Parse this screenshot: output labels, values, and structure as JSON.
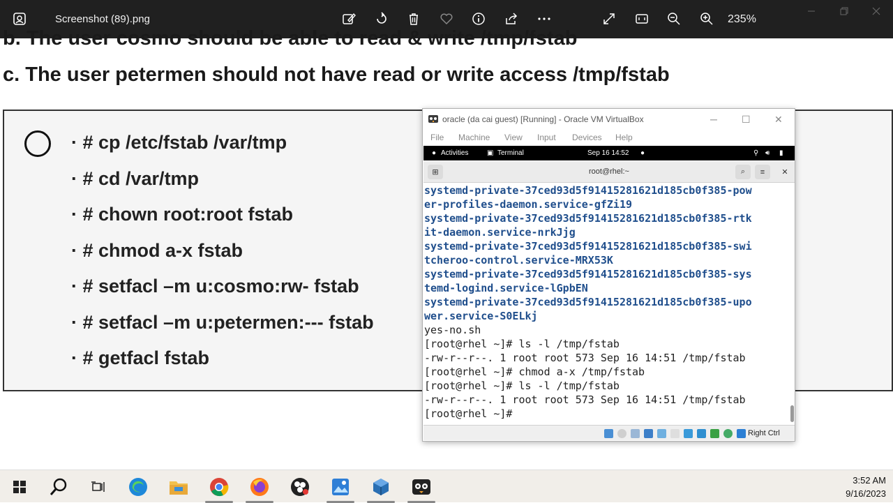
{
  "viewer": {
    "file_title": "Screenshot (89).png",
    "zoom_level": "235%",
    "icons": [
      "edit-image-icon",
      "rotate-icon",
      "delete-icon",
      "favorite-icon",
      "info-icon",
      "share-icon",
      "more-icon",
      "fullscreen-icon",
      "fit-icon",
      "zoom-out-icon",
      "zoom-in-icon"
    ]
  },
  "slide": {
    "line_b": "b. The user cosmo should be able to read & write /tmp/fstab",
    "line_c": "c. The user petermen should not have read or write access /tmp/fstab",
    "commands": [
      "· # cp /etc/fstab /var/tmp",
      "· # cd /var/tmp",
      "· # chown root:root fstab",
      "· # chmod a-x fstab",
      "· # setfacl –m u:cosmo:rw- fstab",
      "· # setfacl –m u:petermen:--- fstab",
      "· # getfacl fstab"
    ]
  },
  "vbox": {
    "title": "oracle (da cai guest) [Running] - Oracle VM VirtualBox",
    "menu": [
      "File",
      "Machine",
      "View",
      "Input",
      "Devices",
      "Help"
    ],
    "gnome": {
      "activities": "Activities",
      "terminal": "Terminal",
      "datetime": "Sep 16  14:52"
    },
    "terminal_title": "root@rhel:~",
    "right_ctrl": "Right Ctrl"
  },
  "terminal_lines": [
    {
      "text": "systemd-private-37ced93d5f91415281621d185cb0f385-pow",
      "dir": true
    },
    {
      "text": "er-profiles-daemon.service-gfZi19",
      "dir": true
    },
    {
      "text": "systemd-private-37ced93d5f91415281621d185cb0f385-rtk",
      "dir": true
    },
    {
      "text": "it-daemon.service-nrkJjg",
      "dir": true
    },
    {
      "text": "systemd-private-37ced93d5f91415281621d185cb0f385-swi",
      "dir": true
    },
    {
      "text": "tcheroo-control.service-MRX53K",
      "dir": true
    },
    {
      "text": "systemd-private-37ced93d5f91415281621d185cb0f385-sys",
      "dir": true
    },
    {
      "text": "temd-logind.service-lGpbEN",
      "dir": true
    },
    {
      "text": "systemd-private-37ced93d5f91415281621d185cb0f385-upo",
      "dir": true
    },
    {
      "text": "wer.service-S0ELkj",
      "dir": true
    },
    {
      "text": "yes-no.sh",
      "dir": false
    },
    {
      "text": "[root@rhel ~]# ls -l /tmp/fstab",
      "dir": false
    },
    {
      "text": "-rw-r--r--. 1 root root 573 Sep 16 14:51 /tmp/fstab",
      "dir": false
    },
    {
      "text": "[root@rhel ~]# chmod a-x /tmp/fstab",
      "dir": false
    },
    {
      "text": "[root@rhel ~]# ls -l /tmp/fstab",
      "dir": false
    },
    {
      "text": "-rw-r--r--. 1 root root 573 Sep 16 14:51 /tmp/fstab",
      "dir": false
    },
    {
      "text": "[root@rhel ~]#",
      "dir": false
    }
  ],
  "taskbar": {
    "apps": [
      "start-icon",
      "search-icon",
      "task-view-icon",
      "edge-icon",
      "file-explorer-icon",
      "chrome-icon",
      "firefox-icon",
      "obs-icon",
      "photos-icon",
      "virtualbox-icon",
      "app-icon"
    ],
    "time": "3:52 AM",
    "date": "9/16/2023"
  }
}
